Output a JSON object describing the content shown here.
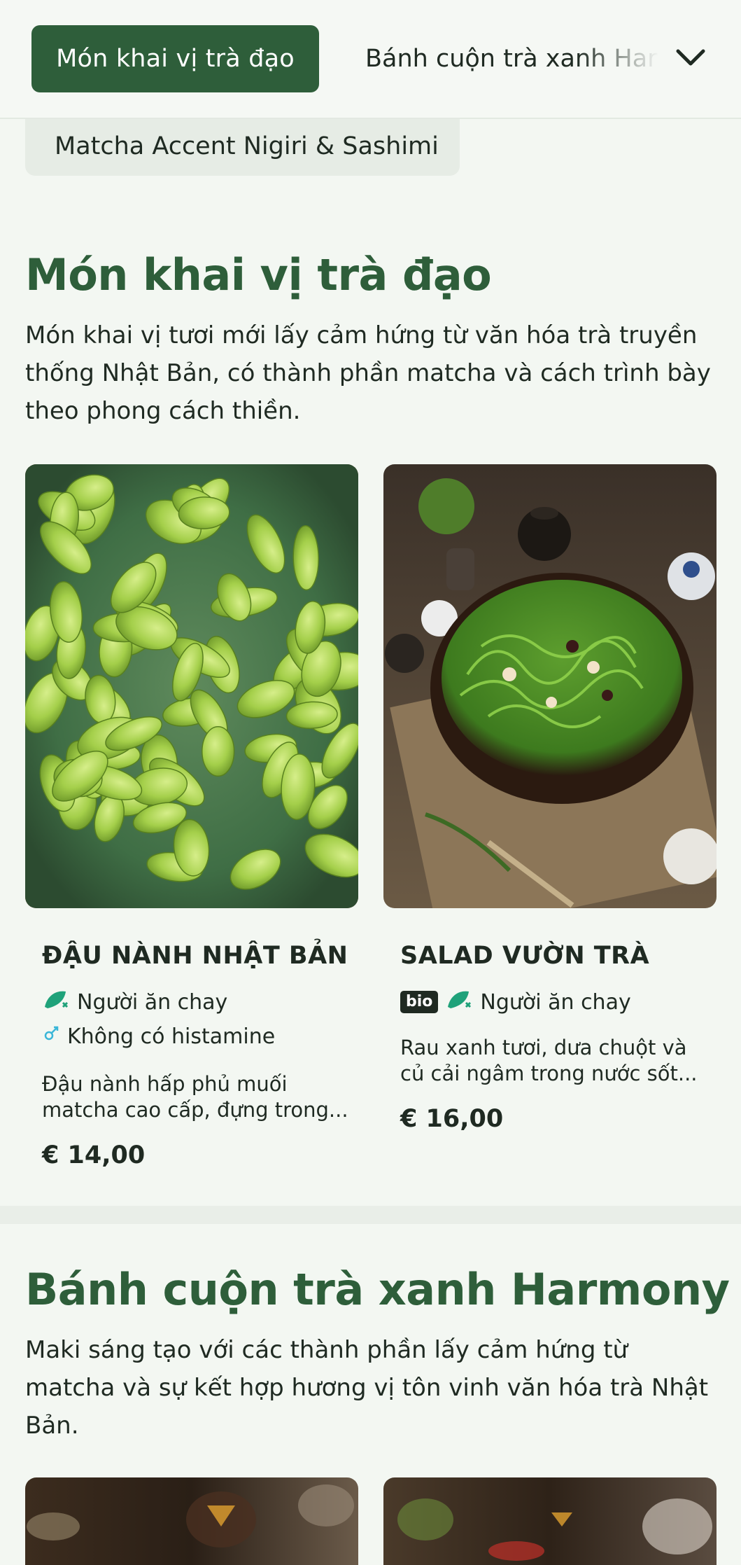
{
  "nav": {
    "active_tab": "Món khai vị trà đạo",
    "next_tab": "Bánh cuộn trà xanh Harmony",
    "sub_chip": "Matcha Accent Nigiri & Sashimi"
  },
  "colors": {
    "brand_green": "#2e5e3a",
    "icon_green": "#1fa27a",
    "background": "#f3f7f2"
  },
  "sections": [
    {
      "title": "Món khai vị trà đạo",
      "description": "Món khai vị tươi mới lấy cảm hứng từ văn hóa trà truyền thống Nhật Bản, có thành phần matcha và cách trình bày theo phong cách thiền.",
      "items": [
        {
          "name": "ĐẬU NÀNH NHẬT BẢN",
          "tags": [
            "Người ăn chay",
            "Không có histamine"
          ],
          "description": "Đậu nành hấp phủ muối matcha cao cấp, đựng trong...",
          "price": "€ 14,00"
        },
        {
          "name": "SALAD VƯỜN TRÀ",
          "badge": "bio",
          "tags": [
            "Người ăn chay"
          ],
          "description": "Rau xanh tươi, dưa chuột và củ cải ngâm trong nước sốt...",
          "price": "€ 16,00"
        }
      ]
    },
    {
      "title": "Bánh cuộn trà xanh Harmony",
      "description": "Maki sáng tạo với các thành phần lấy cảm hứng từ matcha và sự kết hợp hương vị tôn vinh văn hóa trà Nhật Bản."
    }
  ]
}
